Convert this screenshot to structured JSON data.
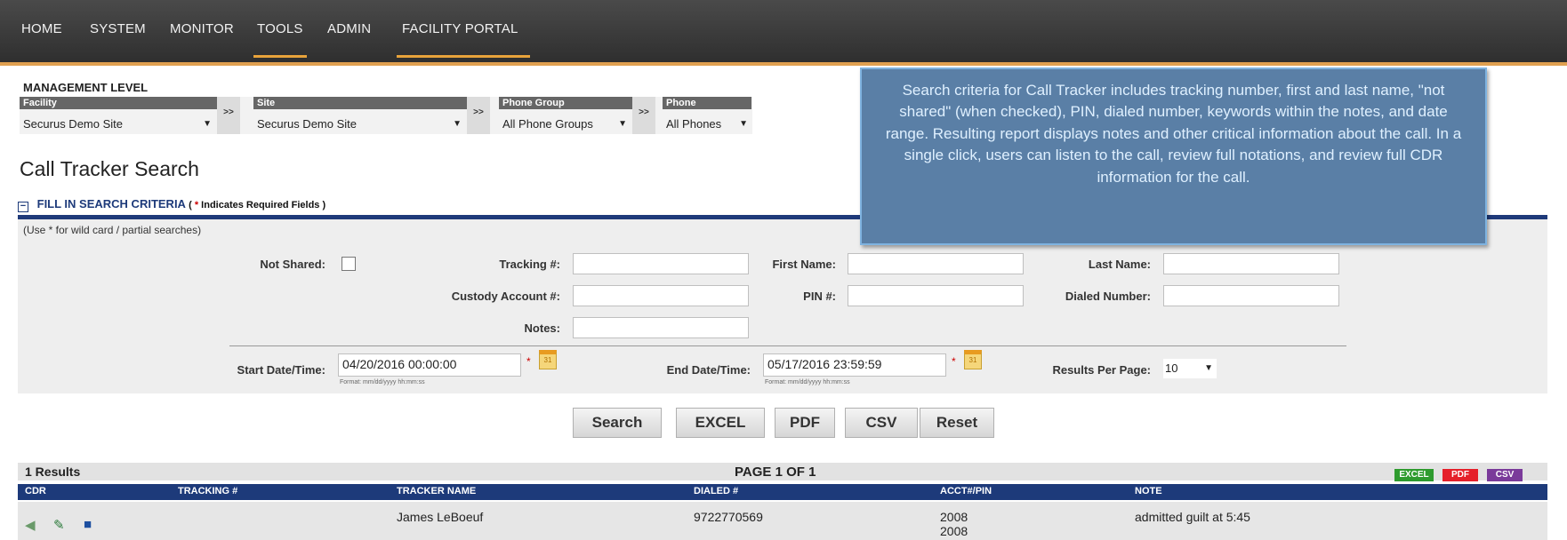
{
  "nav": {
    "items": [
      "HOME",
      "SYSTEM",
      "MONITOR",
      "TOOLS",
      "ADMIN",
      "FACILITY PORTAL"
    ]
  },
  "management": {
    "title": "MANAGEMENT LEVEL",
    "facility_label": "Facility",
    "facility_value": "Securus Demo Site",
    "site_label": "Site",
    "site_value": "Securus Demo Site",
    "phone_group_label": "Phone Group",
    "phone_group_value": "All Phone Groups",
    "phone_label": "Phone",
    "phone_value": "All Phones",
    "arrow": ">>"
  },
  "page_title": "Call Tracker Search",
  "fill": {
    "toggle": "−",
    "heading": "FILL IN SEARCH CRITERIA",
    "required_note_open": "( ",
    "required_star": "*",
    "required_note": " Indicates Required Fields )",
    "wildcard_note": "(Use * for wild card / partial searches)"
  },
  "form": {
    "not_shared_label": "Not Shared:",
    "tracking_label": "Tracking #:",
    "tracking_value": "",
    "first_name_label": "First Name:",
    "first_name_value": "",
    "last_name_label": "Last Name:",
    "last_name_value": "",
    "custody_label": "Custody Account #:",
    "custody_value": "",
    "pin_label": "PIN #:",
    "pin_value": "",
    "dialed_label": "Dialed Number:",
    "dialed_value": "",
    "notes_label": "Notes:",
    "notes_value": "",
    "start_label": "Start Date/Time:",
    "start_value": "04/20/2016 00:00:00",
    "end_label": "End Date/Time:",
    "end_value": "05/17/2016 23:59:59",
    "format_hint": "Format: mm/dd/yyyy hh:mm:ss",
    "results_per_page_label": "Results Per Page:",
    "results_per_page_value": "10",
    "required_star": "*",
    "calendar_glyph": "31"
  },
  "buttons": {
    "search": "Search",
    "excel": "EXCEL",
    "pdf": "PDF",
    "csv": "CSV",
    "reset": "Reset"
  },
  "results": {
    "count_label": "1  Results",
    "page_label": "PAGE 1 OF 1",
    "export_excel": "EXCEL",
    "export_pdf": "PDF",
    "export_csv": "CSV",
    "columns": [
      "CDR",
      "TRACKING #",
      "TRACKER NAME",
      "DIALED #",
      "ACCT#/PIN",
      "NOTE"
    ],
    "rows": [
      {
        "tracking": "",
        "name": "James LeBoeuf",
        "dialed": "9722770569",
        "acct": "2008",
        "pin": "2008",
        "note": "admitted guilt at 5:45",
        "icons": [
          "speaker-icon",
          "cdr-icon",
          "notes-icon"
        ]
      }
    ]
  },
  "callout": {
    "text": "Search criteria for Call Tracker includes tracking number, first and last name, \"not shared\" (when checked), PIN, dialed number, keywords within the notes, and date range. Resulting report displays notes and other critical information about the call. In a single click, users can listen to the call, review full notations, and review full CDR information for the call."
  },
  "colors": {
    "nav_bg": "#3a3a3a",
    "accent_orange": "#e8a33b",
    "header_blue": "#1d3a7a",
    "callout_bg": "#5a7fa6",
    "excel_green": "#2e9b2e",
    "pdf_red": "#e5202a",
    "csv_purple": "#7a3a9a"
  }
}
